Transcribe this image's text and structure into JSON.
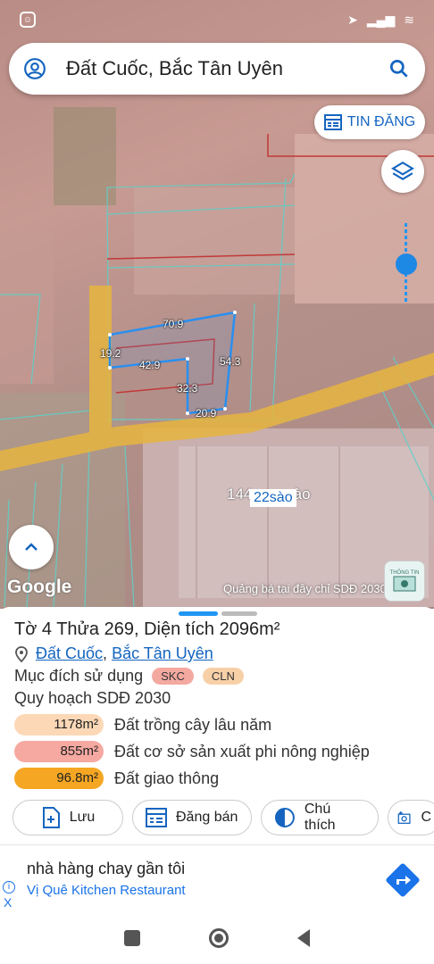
{
  "search": {
    "text": "Đất Cuốc, Bắc Tân Uyên"
  },
  "map": {
    "tin_dang_label": "TIN ĐĂNG",
    "dimensions": [
      "70.9",
      "19.2",
      "42.9",
      "54.3",
      "32.3",
      "20.9"
    ],
    "area_label": "144",
    "area_label_suffix": "sào",
    "area_badge": "22sào",
    "google": "Google",
    "ad_overlay": "Quảng bá tại đây chỉ SDĐ 2030",
    "thong_tin": "THÔNG TIN"
  },
  "sheet": {
    "title": "Tờ 4 Thửa 269, Diện tích 2096m²",
    "location_1": "Đất Cuốc",
    "location_sep": ", ",
    "location_2": "Bắc Tân Uyên",
    "purpose_label": "Mục đích sử dụng",
    "chips": [
      {
        "label": "SKC",
        "color": "#f4a9a0"
      },
      {
        "label": "CLN",
        "color": "#f8d0a8"
      }
    ],
    "planning_title": "Quy hoạch SDĐ 2030",
    "plans": [
      {
        "value": "1178m²",
        "label": "Đất trồng cây lâu năm",
        "color": "#fcd8b6"
      },
      {
        "value": "855m²",
        "label": "Đất cơ sở sản xuất phi nông nghiệp",
        "color": "#f6a9a1"
      },
      {
        "value": "96.8m²",
        "label": "Đất giao thông",
        "color": "#f5a623"
      }
    ],
    "actions": [
      "Lưu",
      "Đăng bán",
      "Chú thích",
      "C"
    ]
  },
  "ad": {
    "title": "nhà hàng chay gần tôi",
    "subtitle": "Vị Quê Kitchen Restaurant",
    "info": "i",
    "close": "X"
  }
}
